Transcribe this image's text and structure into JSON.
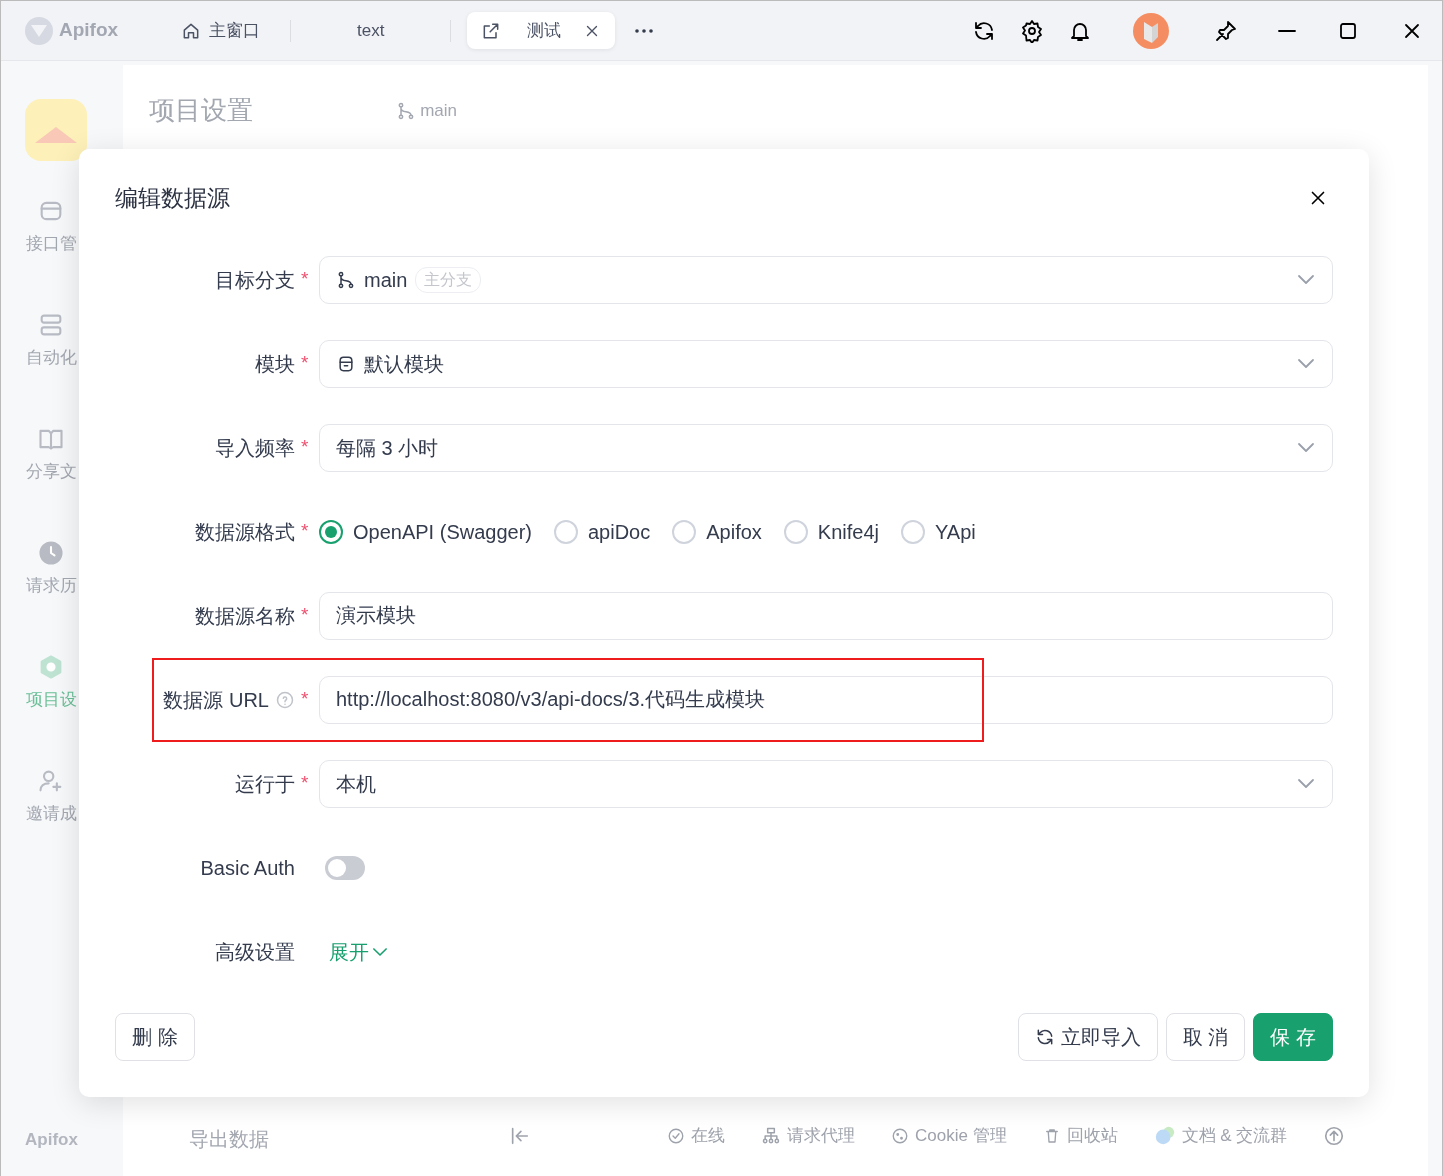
{
  "titlebar": {
    "app_name": "Apifox",
    "tabs": [
      {
        "label": "主窗口",
        "kind": "home",
        "selected": false
      },
      {
        "label": "text",
        "kind": "plain",
        "selected": false
      },
      {
        "label": "测试",
        "kind": "popout",
        "selected": true
      }
    ]
  },
  "background": {
    "sidebar": [
      {
        "label": "接口管",
        "kind": "api",
        "selected": false
      },
      {
        "label": "自动化",
        "kind": "auto",
        "selected": false
      },
      {
        "label": "分享文",
        "kind": "book",
        "selected": false
      },
      {
        "label": "请求历",
        "kind": "clock",
        "selected": false
      },
      {
        "label": "项目设",
        "kind": "settings",
        "selected": true
      },
      {
        "label": "邀请成",
        "kind": "invite",
        "selected": false
      }
    ],
    "sidebar_brand": "Apifox",
    "panel_title": "项目设置",
    "branch": "main",
    "panel_footer": "导出数据",
    "status_bar": [
      {
        "label": "在线",
        "kind": "online"
      },
      {
        "label": "请求代理",
        "kind": "proxy"
      },
      {
        "label": "Cookie 管理",
        "kind": "cookie"
      },
      {
        "label": "回收站",
        "kind": "trash"
      },
      {
        "label": "文档 & 交流群",
        "kind": "chat"
      }
    ]
  },
  "dialog": {
    "title": "编辑数据源",
    "fields": [
      {
        "kind": "select",
        "label": "目标分支",
        "required_mark": "*",
        "value": "main",
        "tag": "主分支"
      },
      {
        "kind": "select",
        "label": "模块",
        "required_mark": "*",
        "value": "默认模块"
      },
      {
        "kind": "select",
        "label": "导入频率",
        "required_mark": "*",
        "value": "每隔 3 小时"
      },
      {
        "kind": "radio",
        "label": "数据源格式",
        "required_mark": "*",
        "options": [
          {
            "label": "OpenAPI (Swagger)",
            "selected": true
          },
          {
            "label": "apiDoc",
            "selected": false
          },
          {
            "label": "Apifox",
            "selected": false
          },
          {
            "label": "Knife4j",
            "selected": false
          },
          {
            "label": "YApi",
            "selected": false
          }
        ]
      },
      {
        "kind": "input",
        "label": "数据源名称",
        "required_mark": "*",
        "value": "演示模块"
      },
      {
        "kind": "input",
        "label": "数据源 URL",
        "required_mark": "*",
        "help": true,
        "highlighted": true,
        "value": "http://localhost:8080/v3/api-docs/3.代码生成模块"
      },
      {
        "kind": "select",
        "label": "运行于",
        "required_mark": "*",
        "value": "本机"
      },
      {
        "kind": "switch",
        "label": "Basic Auth",
        "on": false
      },
      {
        "kind": "expand",
        "label": "高级设置",
        "link": "展开",
        "expanded": false
      }
    ],
    "buttons": [
      {
        "label": "删 除",
        "kind": "delete"
      },
      {
        "label": "立即导入",
        "kind": "import"
      },
      {
        "label": "取 消",
        "kind": "cancel"
      },
      {
        "label": "保 存",
        "kind": "save"
      }
    ]
  }
}
